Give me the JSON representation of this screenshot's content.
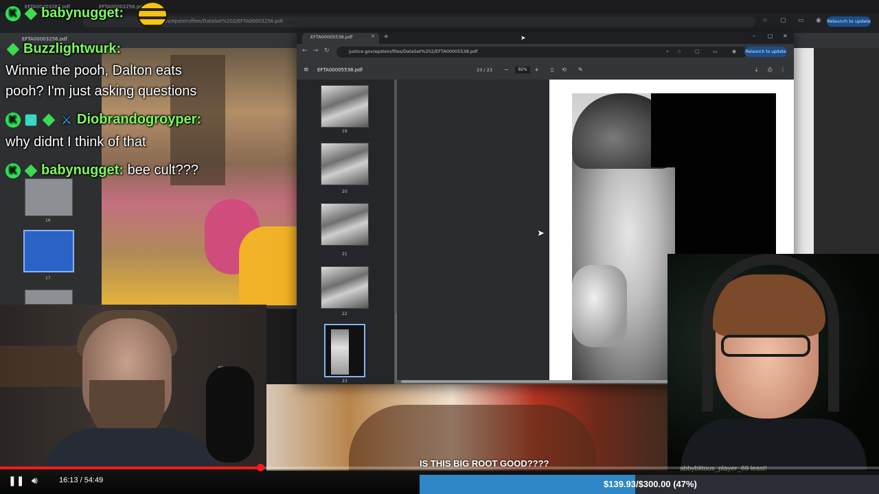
{
  "background_browser": {
    "tabs": [
      "EFTA00003287.pdf",
      "EFTA00003256.pdf"
    ],
    "url": "justice.gov/epstein/files/DataSet%202/EFTA00003256.pdf",
    "pdf_name": "EFTA00003256.pdf",
    "relaunch_label": "Relaunch to update",
    "thumb_numbers": [
      "16",
      "17"
    ]
  },
  "pdf_window": {
    "tab_title": "EFTA00005538.pdf",
    "url": "justice.gov/epstein/files/DataSet%202/EFTA00005538.pdf",
    "relaunch_label": "Relaunch to update",
    "filename": "EFTA00005538.pdf",
    "page_indicator": "23 / 23",
    "zoom": "92%",
    "thumbnails": [
      {
        "num": "19"
      },
      {
        "num": "20"
      },
      {
        "num": "21"
      },
      {
        "num": "22"
      },
      {
        "num": "23",
        "current": true
      }
    ]
  },
  "chat": {
    "messages": [
      {
        "user": "babynugget:",
        "text": ""
      },
      {
        "user": "Buzzlightwurk:",
        "text": "Winnie the pooh, Dalton eats"
      },
      {
        "user": "",
        "text": "pooh? I'm just asking questions"
      },
      {
        "user": "Diobrandogroyper:",
        "text": ""
      },
      {
        "user": "",
        "text": "why didnt I think of that"
      },
      {
        "user": "babynugget:",
        "text": "bee cult???"
      }
    ]
  },
  "caption": "IS THIS BIG ROOT GOOD????",
  "ticker": "abbyblitous_player_69",
  "ticker_end": "least!",
  "player": {
    "time": "16:13 / 54:49",
    "progress": 0.296,
    "play_icon": "pause-icon",
    "volume_icon": "volume-icon"
  },
  "goal": {
    "text": "$139.93/$300.00 (47%)",
    "progress": 0.47,
    "fill_color": "#2f87c7"
  }
}
